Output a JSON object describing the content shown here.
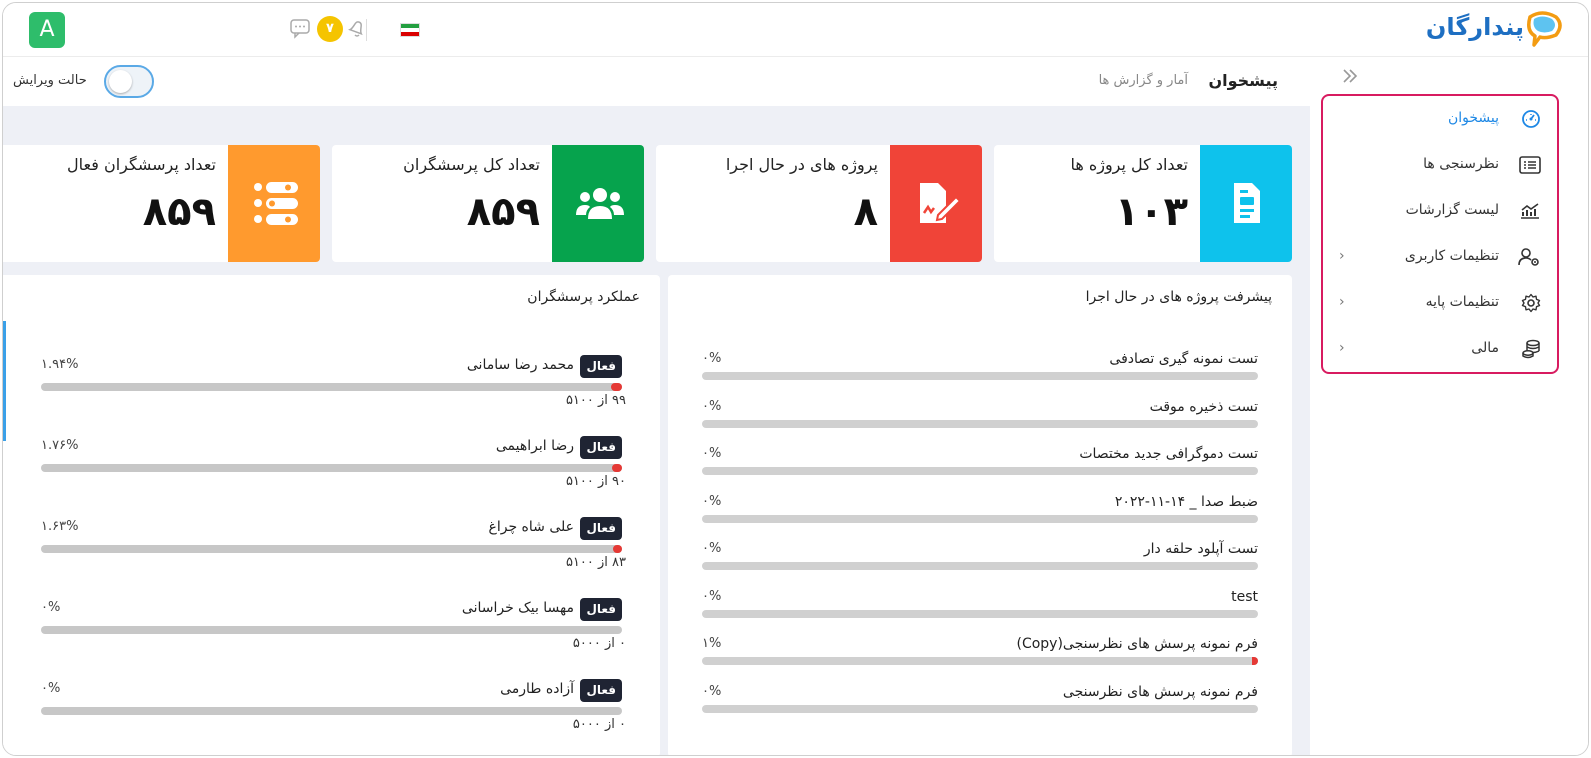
{
  "header": {
    "avatar_letter": "A",
    "notification_count": "۷",
    "logo_text": "پندارگان"
  },
  "colors": {
    "accent": "#1e88e5",
    "card_blue": "#0ec2ec",
    "card_red": "#f04438",
    "card_green": "#06a34d",
    "card_orange": "#ff9a2e",
    "badge": "#1f2433",
    "progress_fill": "#e53935",
    "menu_border": "#d81b60"
  },
  "topbar": {
    "title": "پیشخوان",
    "breadcrumb": "آمار و گزارش ها",
    "edit_mode_label": "حالت ویرایش",
    "edit_mode_on": false
  },
  "sidebar": {
    "items": [
      {
        "label": "پیشخوان",
        "icon": "dashboard-icon",
        "active": true,
        "chevron": ""
      },
      {
        "label": "نظرسنجی ها",
        "icon": "list-icon",
        "active": false,
        "chevron": ""
      },
      {
        "label": "لیست گزارشات",
        "icon": "chart-icon",
        "active": false,
        "chevron": ""
      },
      {
        "label": "تنظیمات کاربری",
        "icon": "user-settings-icon",
        "active": false,
        "chevron": "‹"
      },
      {
        "label": "تنظیمات پایه",
        "icon": "gear-icon",
        "active": false,
        "chevron": "‹"
      },
      {
        "label": "مالی",
        "icon": "coins-icon",
        "active": false,
        "chevron": "‹"
      }
    ]
  },
  "cards": [
    {
      "title": "تعداد کل پروژه ها",
      "value": "۱۰۳",
      "icon": "document-icon"
    },
    {
      "title": "پروژه های در حال اجرا",
      "value": "۸",
      "icon": "file-signature-icon"
    },
    {
      "title": "تعداد کل پرسشگران",
      "value": "۸۵۹",
      "icon": "users-icon"
    },
    {
      "title": "تعداد پرسشگران فعال",
      "value": "۸۵۹",
      "icon": "toggle-list-icon"
    }
  ],
  "projects_panel": {
    "title": "پیشرفت پروژه های در حال اجرا",
    "rows": [
      {
        "name": "تست نمونه گیری تصادفی",
        "percent": "۰%",
        "progress": 0
      },
      {
        "name": "تست ذخیره موقت",
        "percent": "۰%",
        "progress": 0
      },
      {
        "name": "تست دموگرافی جدید مختصات",
        "percent": "۰%",
        "progress": 0
      },
      {
        "name": "ضبط صدا _ ۱۴-۱۱-۲۰۲۲",
        "percent": "۰%",
        "progress": 0
      },
      {
        "name": "تست آپلود حلقه دار",
        "percent": "۰%",
        "progress": 0
      },
      {
        "name": "test",
        "percent": "۰%",
        "progress": 0
      },
      {
        "name": "فرم نمونه پرسش های نظرسنجی(Copy)",
        "percent": "۱%",
        "progress": 0.01
      },
      {
        "name": "فرم نمونه پرسش های نظرسنجی",
        "percent": "۰%",
        "progress": 0
      }
    ]
  },
  "surveyors_panel": {
    "title": "عملکرد پرسشگران",
    "rows": [
      {
        "badge": "فعال",
        "name": "محمد رضا سامانی",
        "percent": "۱.۹۴%",
        "count": "۹۹ از ۵۱۰۰",
        "progress": 0.0194
      },
      {
        "badge": "فعال",
        "name": "رضا ابراهیمی",
        "percent": "۱.۷۶%",
        "count": "۹۰ از ۵۱۰۰",
        "progress": 0.0176
      },
      {
        "badge": "فعال",
        "name": "علی شاه چراغ",
        "percent": "۱.۶۳%",
        "count": "۸۳ از ۵۱۰۰",
        "progress": 0.0163
      },
      {
        "badge": "فعال",
        "name": "مهسا بیک خراسانی",
        "percent": "۰%",
        "count": "۰ از ۵۰۰۰",
        "progress": 0
      },
      {
        "badge": "فعال",
        "name": "آزاده طارمی",
        "percent": "۰%",
        "count": "۰ از ۵۰۰۰",
        "progress": 0
      }
    ]
  }
}
